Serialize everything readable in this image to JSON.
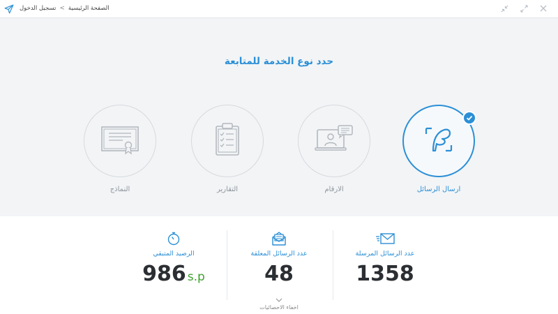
{
  "breadcrumb": {
    "home": "الصفحة الرئيسية",
    "current": "تسجيل الدخول"
  },
  "selection": {
    "title": "حدد نوع الخدمة للمتابعة",
    "services": [
      {
        "label": "ارسال الرسائل",
        "icon": "message-feather-icon",
        "selected": true
      },
      {
        "label": "الارقام",
        "icon": "video-chat-icon",
        "selected": false
      },
      {
        "label": "التقارير",
        "icon": "clipboard-checklist-icon",
        "selected": false
      },
      {
        "label": "النماذج",
        "icon": "certificate-icon",
        "selected": false
      }
    ]
  },
  "stats": {
    "sent": {
      "label": "عدد الرسائل المرسلة",
      "value": "1358",
      "icon": "envelope-icon"
    },
    "pending": {
      "label": "عدد الرسائل المعلقة",
      "value": "48",
      "icon": "open-envelope-icon"
    },
    "balance": {
      "label": "الرصيد المتبقي",
      "value": "986",
      "unit": "s.p",
      "icon": "stopwatch-icon"
    },
    "toggle_label": "اخفاء الاحصائيات"
  },
  "colors": {
    "accent": "#2b8fd6",
    "unit": "#3da12e",
    "icon_gray": "#b3b8be"
  }
}
